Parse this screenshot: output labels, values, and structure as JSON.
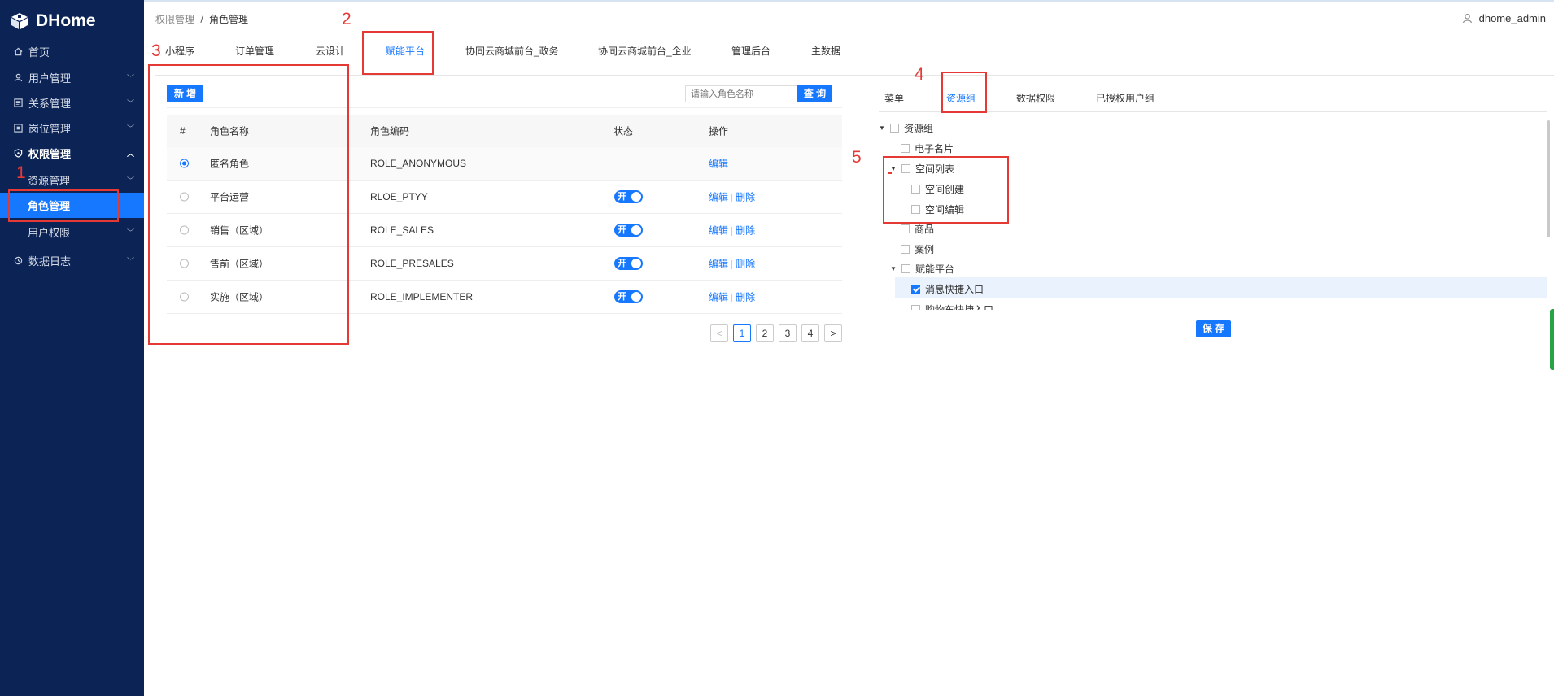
{
  "app": {
    "name": "DHome"
  },
  "sidebar": {
    "items": [
      {
        "label": "首页",
        "icon": "home-icon"
      },
      {
        "label": "用户管理",
        "icon": "user-icon",
        "chevron": "﹀"
      },
      {
        "label": "关系管理",
        "icon": "relation-icon",
        "chevron": "﹀"
      },
      {
        "label": "岗位管理",
        "icon": "post-icon",
        "chevron": "﹀"
      },
      {
        "label": "权限管理",
        "icon": "shield-icon",
        "chevron": "︿"
      },
      {
        "label": "资源管理",
        "chevron": "﹀"
      },
      {
        "label": "角色管理"
      },
      {
        "label": "用户权限",
        "chevron": "﹀"
      },
      {
        "label": "数据日志",
        "icon": "log-icon",
        "chevron": "﹀"
      }
    ]
  },
  "header": {
    "breadcrumb": {
      "parent": "权限管理",
      "separator": "/",
      "current": "角色管理"
    },
    "username": "dhome_admin"
  },
  "tabs": [
    "小程序",
    "订单管理",
    "云设计",
    "赋能平台",
    "协同云商城前台_政务",
    "协同云商城前台_企业",
    "管理后台",
    "主数据"
  ],
  "left": {
    "new_button": "新 增",
    "search_placeholder": "请输入角色名称",
    "query_button": "查 询",
    "columns": [
      "#",
      "角色名称",
      "角色编码",
      "状态",
      "操作"
    ],
    "rows": [
      {
        "name": "匿名角色",
        "code": "ROLE_ANONYMOUS",
        "status": "",
        "actions": [
          "编辑"
        ]
      },
      {
        "name": "平台运营",
        "code": "RLOE_PTYY",
        "status": "开",
        "actions": [
          "编辑",
          "删除"
        ]
      },
      {
        "name": "销售（区域）",
        "code": "ROLE_SALES",
        "status": "开",
        "actions": [
          "编辑",
          "删除"
        ]
      },
      {
        "name": "售前（区域）",
        "code": "ROLE_PRESALES",
        "status": "开",
        "actions": [
          "编辑",
          "删除"
        ]
      },
      {
        "name": "实施（区域）",
        "code": "ROLE_IMPLEMENTER",
        "status": "开",
        "actions": [
          "编辑",
          "删除"
        ]
      }
    ],
    "action_separator": "|",
    "pagination": {
      "prev": "<",
      "pages": [
        "1",
        "2",
        "3",
        "4"
      ],
      "next": ">",
      "current": "1"
    }
  },
  "right": {
    "tabs": [
      "菜单",
      "资源组",
      "数据权限",
      "已授权用户组"
    ],
    "tree": [
      {
        "label": "资源组",
        "expanded": true,
        "checked": false
      },
      {
        "label": "电子名片",
        "checked": false
      },
      {
        "label": "空间列表",
        "expanded": true,
        "checked": false
      },
      {
        "label": "空间创建",
        "checked": false
      },
      {
        "label": "空间编辑",
        "checked": false
      },
      {
        "label": "商品",
        "checked": false
      },
      {
        "label": "案例",
        "checked": false
      },
      {
        "label": "赋能平台",
        "expanded": true,
        "checked": false
      },
      {
        "label": "消息快捷入口",
        "checked": true
      },
      {
        "label": "购物车快捷入口",
        "checked": false
      }
    ],
    "save_button": "保 存"
  },
  "annotations": [
    "1",
    "2",
    "3",
    "4",
    "5"
  ],
  "colors": {
    "sidebar": "#0c2455",
    "accent": "#1677ff",
    "annotation": "#e53935"
  }
}
